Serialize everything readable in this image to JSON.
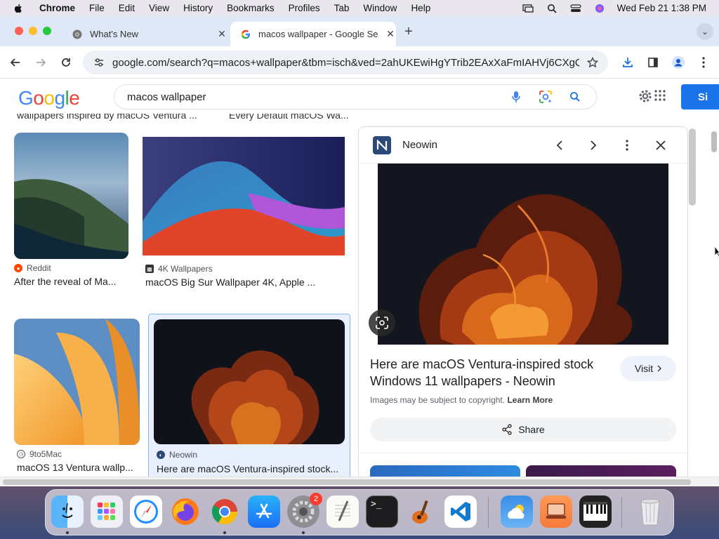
{
  "menubar": {
    "app_name": "Chrome",
    "items": [
      "File",
      "Edit",
      "View",
      "History",
      "Bookmarks",
      "Profiles",
      "Tab",
      "Window",
      "Help"
    ],
    "datetime": "Wed Feb 21  1:38 PM"
  },
  "tabs": [
    {
      "title": "What's New",
      "icon": "chrome-icon"
    },
    {
      "title": "macos wallpaper - Google Se",
      "icon": "google-g-icon",
      "active": true
    }
  ],
  "toolbar": {
    "url": "google.com/search?q=macos+wallpaper&tbm=isch&ved=2ahUKEwiHgYTrib2EAxXaFmIAHVj6CXgQ..."
  },
  "google": {
    "logo": "Google",
    "query": "macos wallpaper",
    "signin_label": "Si"
  },
  "results": {
    "clipped_captions": [
      "wallpapers inspired by macOS Ventura ...",
      "Every Default macOS Wa..."
    ],
    "cards": [
      {
        "source": "Reddit",
        "caption": "After the reveal of Ma..."
      },
      {
        "source": "4K Wallpapers",
        "caption": "macOS Big Sur Wallpaper 4K, Apple ..."
      },
      {
        "source": "9to5Mac",
        "caption": "macOS 13 Ventura wallp..."
      },
      {
        "source": "Neowin",
        "caption": "Here are macOS Ventura-inspired stock..."
      }
    ]
  },
  "panel": {
    "source": "Neowin",
    "title": "Here are macOS Ventura-inspired stock Windows 11 wallpapers - Neowin",
    "visit_label": "Visit",
    "copyright_text": "Images may be subject to copyright.",
    "learn_more": "Learn More",
    "share_label": "Share"
  },
  "dock": {
    "apps": [
      "Finder",
      "Launchpad",
      "Safari",
      "Firefox",
      "Chrome",
      "App Store",
      "System Settings",
      "TextEdit",
      "Terminal",
      "Instruments",
      "VS Code",
      "Weather",
      "Screen Sharing",
      "Piano",
      "Trash"
    ],
    "settings_badge": "2"
  },
  "colors": {
    "google_blue": "#4285F4",
    "google_red": "#EA4335",
    "google_yellow": "#FBBC05",
    "google_green": "#34A853",
    "signin_blue": "#1a73e8",
    "selected_card": "#e8f0fe"
  }
}
